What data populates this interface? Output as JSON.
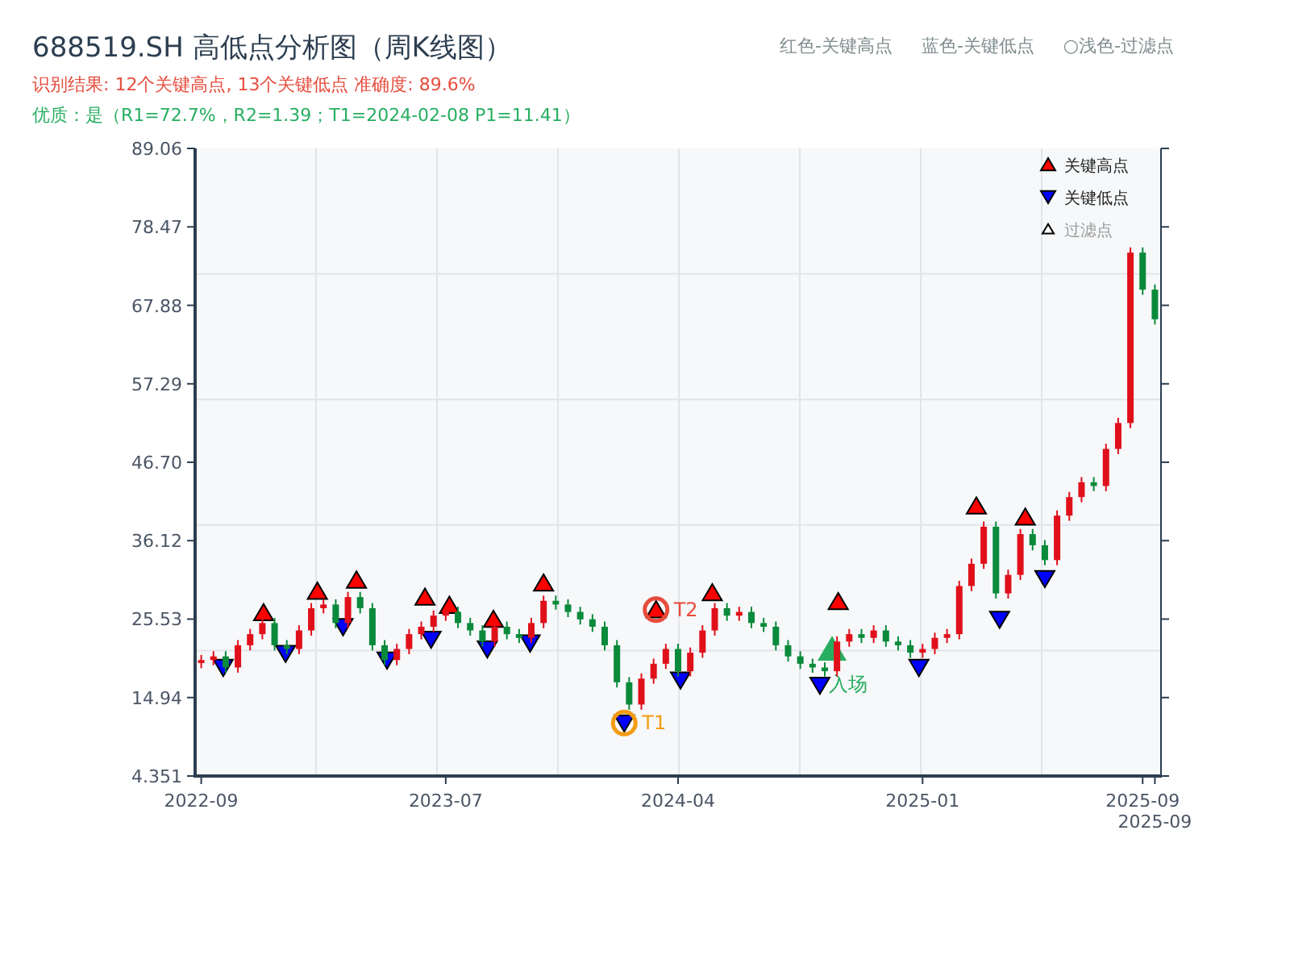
{
  "title": "688519.SH 高低点分析图（周K线图）",
  "summary": "识别结果: 12个关键高点, 13个关键低点   准确度: 89.6%",
  "quality": "优质：是（R1=72.7%，R2=1.39；T1=2024-02-08 P1=11.41）",
  "header_legend": [
    "红色-关键高点",
    "蓝色-关键低点",
    "○浅色-过滤点"
  ],
  "chart": {
    "legend": [
      {
        "kind": "high",
        "label": "关键高点"
      },
      {
        "kind": "low",
        "label": "关键低点"
      },
      {
        "kind": "filtered",
        "label": "过滤点"
      }
    ],
    "chart_data": {
      "type": "candlestick",
      "grid": true,
      "ylim": [
        4.351,
        89.06
      ],
      "yticks": [
        4.351,
        14.94,
        25.53,
        36.12,
        {
          "value": 46.7,
          "label": "46.70"
        },
        57.29,
        67.88,
        78.47,
        89.06
      ],
      "categories": [
        "2022-09",
        null,
        null,
        null,
        null,
        null,
        null,
        null,
        null,
        null,
        null,
        null,
        null,
        null,
        null,
        null,
        null,
        null,
        null,
        null,
        "2023-07",
        null,
        null,
        null,
        null,
        null,
        null,
        null,
        null,
        null,
        null,
        null,
        null,
        null,
        null,
        null,
        null,
        null,
        null,
        "2024-04",
        null,
        null,
        null,
        null,
        null,
        null,
        null,
        null,
        null,
        null,
        null,
        null,
        null,
        null,
        null,
        null,
        null,
        null,
        null,
        "2025-01",
        null,
        null,
        null,
        null,
        null,
        null,
        null,
        null,
        null,
        null,
        null,
        null,
        null,
        null,
        null,
        null,
        null,
        "2025-09",
        "2025-09"
      ],
      "ohlc": [
        [
          19.6,
          20.7,
          18.9,
          20.0
        ],
        [
          20.0,
          21.2,
          19.3,
          20.5
        ],
        [
          20.5,
          21.2,
          18.3,
          19.0
        ],
        [
          19.0,
          22.7,
          18.3,
          22.0
        ],
        [
          22.0,
          24.2,
          21.3,
          23.5
        ],
        [
          23.5,
          25.7,
          22.8,
          25.0
        ],
        [
          25.0,
          25.7,
          21.3,
          22.0
        ],
        [
          22.0,
          22.7,
          20.8,
          21.5
        ],
        [
          21.5,
          24.7,
          20.8,
          24.0
        ],
        [
          24.0,
          27.7,
          23.3,
          27.0
        ],
        [
          27.0,
          28.2,
          26.3,
          27.5
        ],
        [
          27.5,
          28.2,
          24.3,
          25.0
        ],
        [
          25.0,
          29.2,
          24.3,
          28.5
        ],
        [
          28.5,
          29.2,
          26.3,
          27.0
        ],
        [
          27.0,
          27.7,
          21.3,
          22.0
        ],
        [
          22.0,
          22.7,
          19.3,
          20.0
        ],
        [
          20.0,
          22.2,
          19.3,
          21.5
        ],
        [
          21.5,
          24.2,
          20.8,
          23.5
        ],
        [
          23.5,
          25.2,
          22.8,
          24.5
        ],
        [
          24.5,
          26.7,
          23.8,
          26.0
        ],
        [
          26.0,
          27.2,
          25.3,
          26.5
        ],
        [
          26.5,
          27.2,
          24.3,
          25.0
        ],
        [
          25.0,
          25.7,
          23.3,
          24.0
        ],
        [
          24.0,
          24.7,
          21.8,
          22.5
        ],
        [
          22.5,
          25.2,
          21.8,
          24.5
        ],
        [
          24.5,
          25.2,
          22.8,
          23.5
        ],
        [
          23.5,
          24.2,
          22.3,
          23.0
        ],
        [
          23.0,
          25.7,
          22.3,
          25.0
        ],
        [
          25.0,
          28.7,
          24.3,
          28.0
        ],
        [
          28.0,
          28.7,
          26.8,
          27.5
        ],
        [
          27.5,
          28.2,
          25.8,
          26.5
        ],
        [
          26.5,
          27.2,
          24.8,
          25.5
        ],
        [
          25.5,
          26.2,
          23.8,
          24.5
        ],
        [
          24.5,
          25.2,
          21.3,
          22.0
        ],
        [
          22.0,
          22.7,
          16.3,
          17.0
        ],
        [
          17.0,
          17.7,
          13.3,
          14.0
        ],
        [
          14.0,
          18.2,
          13.3,
          17.5
        ],
        [
          17.5,
          20.2,
          16.8,
          19.5
        ],
        [
          19.5,
          22.2,
          18.8,
          21.5
        ],
        [
          21.5,
          22.2,
          17.8,
          18.5
        ],
        [
          18.5,
          21.7,
          17.8,
          21.0
        ],
        [
          21.0,
          24.7,
          20.3,
          24.0
        ],
        [
          24.0,
          27.7,
          23.3,
          27.0
        ],
        [
          27.0,
          27.7,
          25.3,
          26.0
        ],
        [
          26.0,
          27.2,
          25.3,
          26.5
        ],
        [
          26.5,
          27.2,
          24.3,
          25.0
        ],
        [
          25.0,
          25.7,
          23.8,
          24.5
        ],
        [
          24.5,
          25.2,
          21.3,
          22.0
        ],
        [
          22.0,
          22.7,
          19.8,
          20.5
        ],
        [
          20.5,
          21.2,
          18.8,
          19.5
        ],
        [
          19.5,
          20.2,
          18.3,
          19.0
        ],
        [
          19.0,
          19.7,
          17.8,
          18.5
        ],
        [
          18.5,
          23.2,
          17.8,
          22.5
        ],
        [
          22.5,
          24.2,
          21.8,
          23.5
        ],
        [
          23.5,
          24.2,
          22.3,
          23.0
        ],
        [
          23.0,
          24.7,
          22.3,
          24.0
        ],
        [
          24.0,
          24.7,
          21.8,
          22.5
        ],
        [
          22.5,
          23.2,
          21.3,
          22.0
        ],
        [
          22.0,
          22.7,
          20.3,
          21.0
        ],
        [
          21.0,
          22.2,
          20.3,
          21.5
        ],
        [
          21.5,
          23.7,
          20.8,
          23.0
        ],
        [
          23.0,
          24.2,
          22.3,
          23.5
        ],
        [
          23.5,
          30.7,
          22.8,
          30.0
        ],
        [
          30.0,
          33.7,
          29.3,
          33.0
        ],
        [
          33.0,
          38.7,
          32.3,
          38.0
        ],
        [
          38.0,
          38.7,
          28.3,
          29.0
        ],
        [
          29.0,
          32.2,
          28.3,
          31.5
        ],
        [
          31.5,
          37.7,
          30.8,
          37.0
        ],
        [
          37.0,
          37.7,
          34.8,
          35.5
        ],
        [
          35.5,
          36.2,
          32.8,
          33.5
        ],
        [
          33.5,
          40.2,
          32.8,
          39.5
        ],
        [
          39.5,
          42.7,
          38.8,
          42.0
        ],
        [
          42.0,
          44.7,
          41.3,
          44.0
        ],
        [
          44.0,
          44.7,
          42.8,
          43.5
        ],
        [
          43.5,
          49.2,
          42.8,
          48.5
        ],
        [
          48.5,
          52.7,
          47.8,
          52.0
        ],
        [
          52.0,
          75.7,
          51.3,
          75.0
        ],
        [
          75.0,
          75.7,
          69.3,
          70.0
        ],
        [
          70.0,
          70.7,
          65.3,
          66.0
        ]
      ]
    },
    "markers": [
      {
        "kind": "high"
      },
      {
        "kind": "high"
      },
      {
        "kind": "high"
      },
      {
        "kind": "high"
      },
      {
        "kind": "high"
      },
      {
        "kind": "high"
      },
      {
        "kind": "high"
      },
      {
        "kind": "high",
        "label": "T2"
      },
      {
        "kind": "high"
      },
      {
        "kind": "high"
      },
      {
        "kind": "high"
      },
      {
        "kind": "high"
      },
      {
        "kind": "low"
      },
      {
        "kind": "low"
      },
      {
        "kind": "low"
      },
      {
        "kind": "low"
      },
      {
        "kind": "low"
      },
      {
        "kind": "low"
      },
      {
        "kind": "low"
      },
      {
        "kind": "low",
        "label": "T1"
      },
      {
        "kind": "low"
      },
      {
        "kind": "low"
      },
      {
        "kind": "low"
      },
      {
        "kind": "low"
      },
      {
        "kind": "low"
      },
      {
        "kind": "entry",
        "label": "入场"
      }
    ]
  }
}
